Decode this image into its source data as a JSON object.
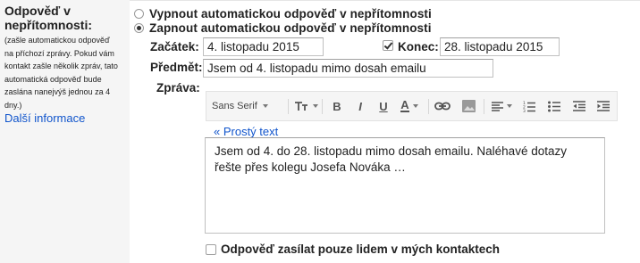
{
  "section": {
    "title": "Odpověď v nepřítomnosti:",
    "help": "(zašle automatickou odpověď na příchozí zprávy. Pokud vám kontakt zašle několik zpráv, tato automatická odpověď bude zaslána nanejvýš jednou za 4 dny.)",
    "more_link": "Další informace"
  },
  "options": {
    "off_label": "Vypnout automatickou odpověď v nepřítomnosti",
    "on_label": "Zapnout automatickou odpověď v nepřítomnosti",
    "selected": "on"
  },
  "form": {
    "start_label": "Začátek:",
    "start_value": "4. listopadu 2015",
    "end_checked": true,
    "end_label": "Konec:",
    "end_value": "28. listopadu 2015",
    "subject_label": "Předmět:",
    "subject_value": "Jsem od 4. listopadu mimo dosah emailu",
    "message_label": "Zpráva:"
  },
  "toolbar": {
    "font": "Sans Serif",
    "buttons": [
      "text-size-icon",
      "bold-icon",
      "italic-icon",
      "underline-icon",
      "text-color-icon",
      "link-icon",
      "image-icon",
      "align-icon",
      "numbered-list-icon",
      "bulleted-list-icon",
      "outdent-icon",
      "indent-icon"
    ]
  },
  "plain_text_link": "« Prostý text",
  "message_body": "Jsem od 4. do 28. listopadu mimo dosah emailu. Naléhavé dotazy řešte přes kolegu Josefa Nováka …",
  "contacts_only": {
    "checked": false,
    "label": "Odpověď zasílat pouze lidem v mých kontaktech"
  }
}
